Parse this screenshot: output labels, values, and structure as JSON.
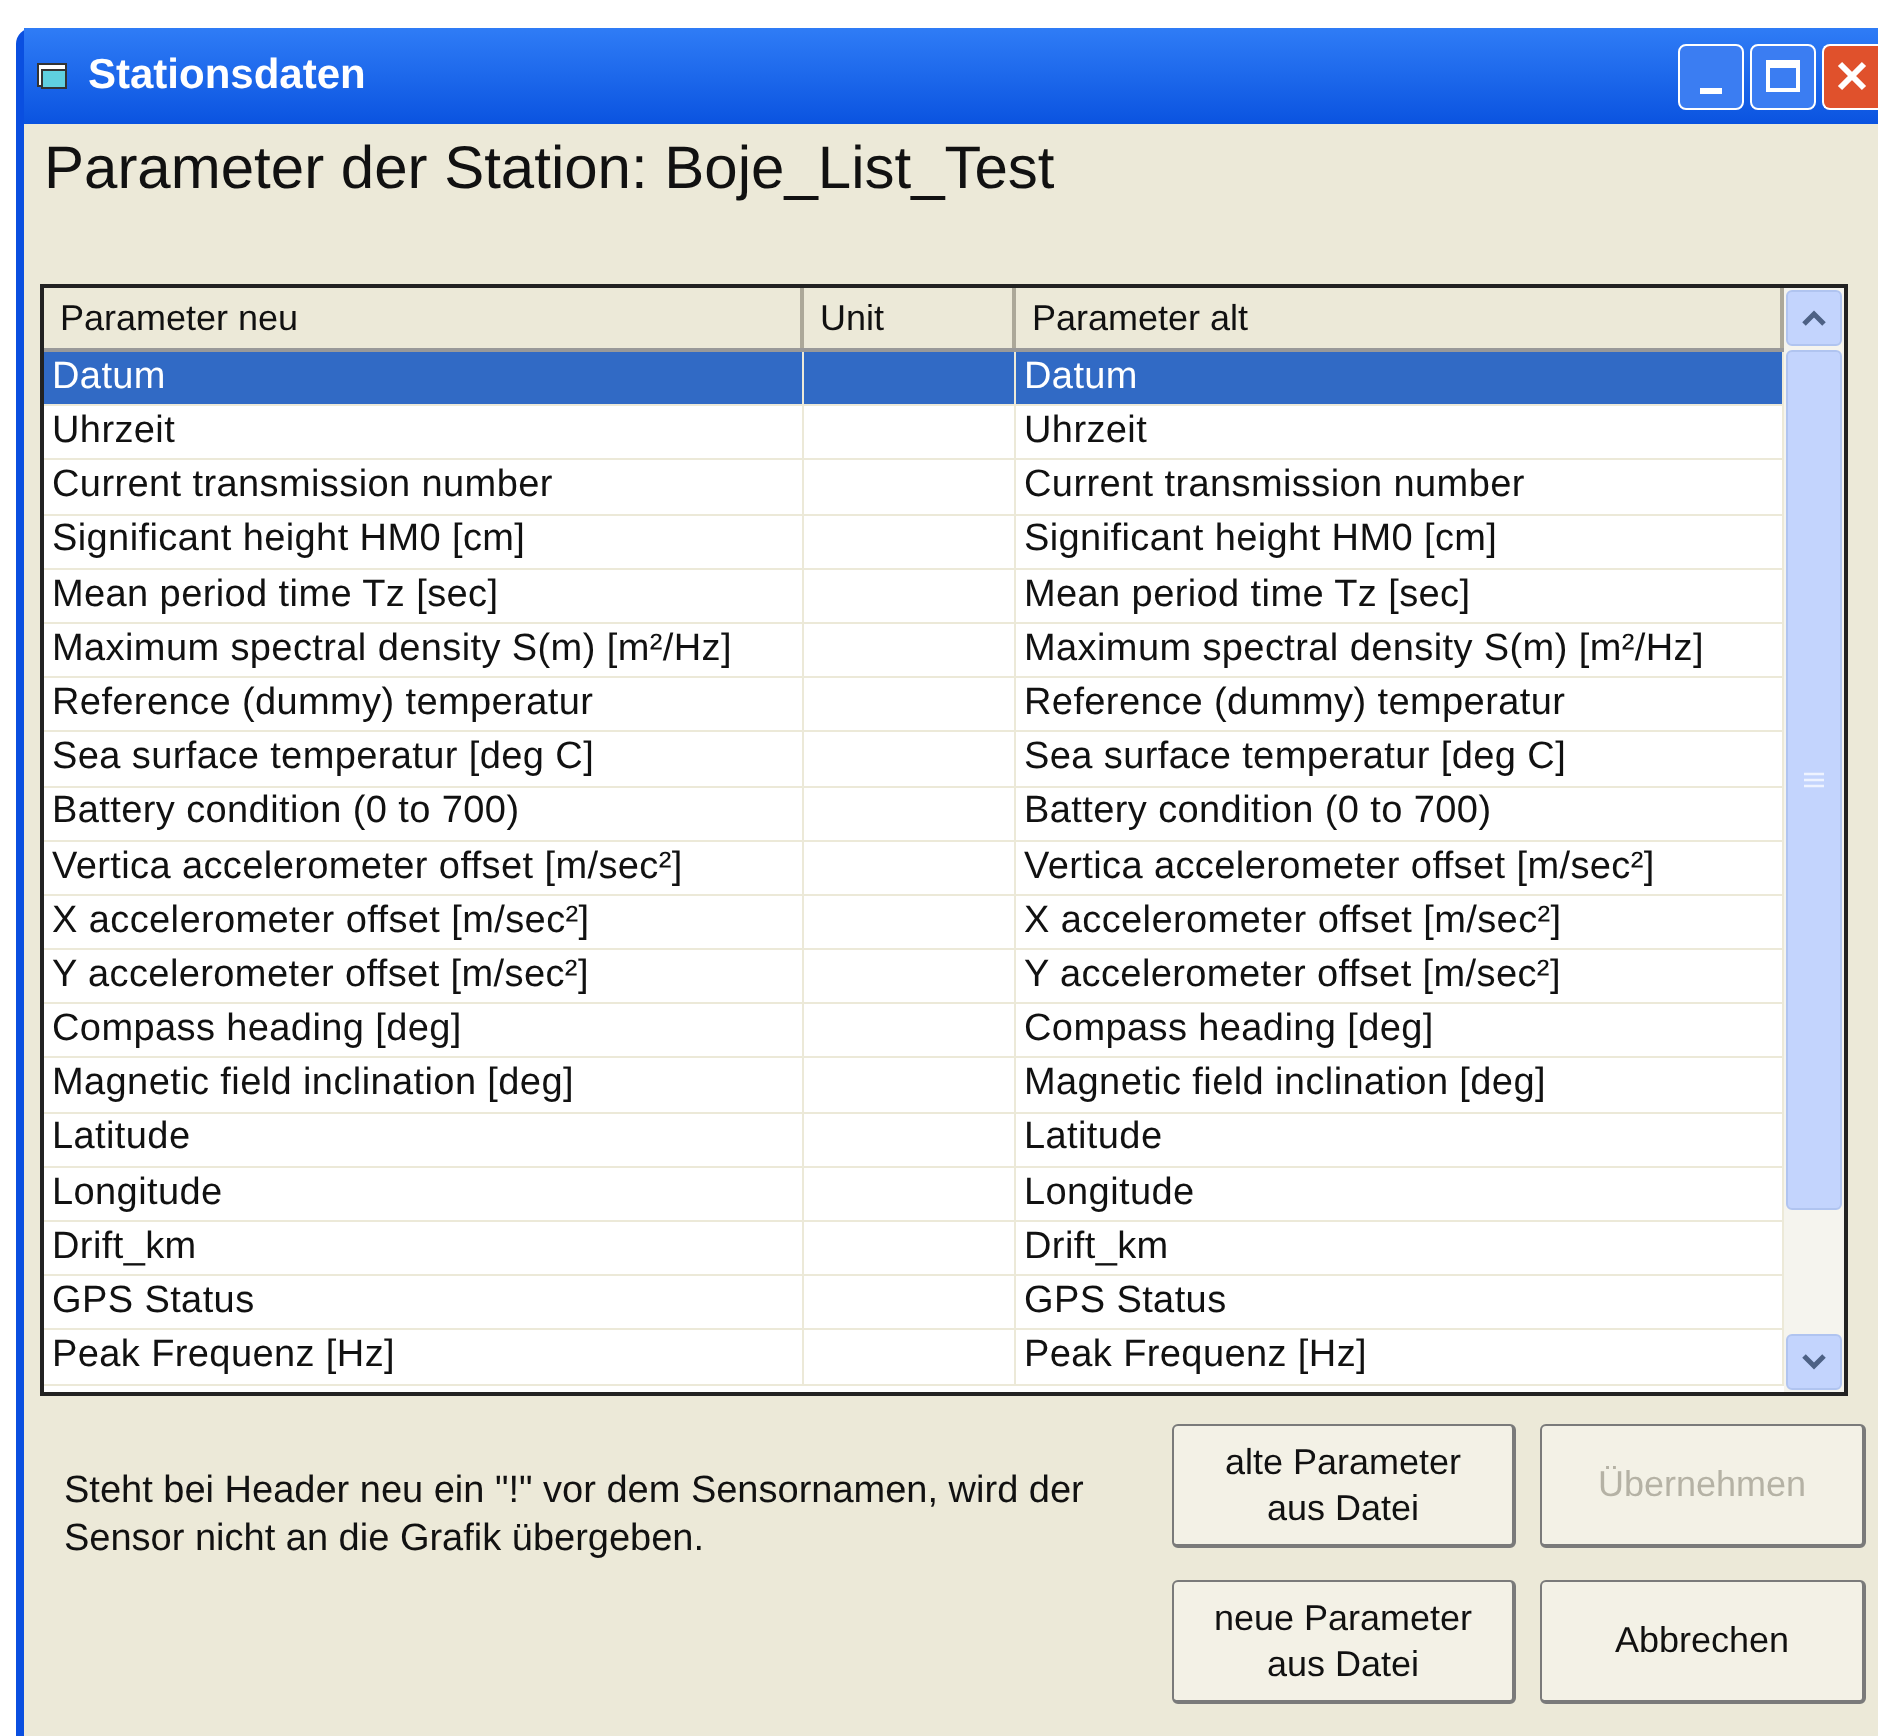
{
  "window": {
    "title": "Stationsdaten"
  },
  "heading": "Parameter der Station: Boje_List_Test",
  "table": {
    "columns": [
      "Parameter neu",
      "Unit",
      "Parameter alt"
    ],
    "rows": [
      {
        "cells": [
          "Datum",
          "",
          "Datum"
        ],
        "selected": true
      },
      {
        "cells": [
          "Uhrzeit",
          "",
          "Uhrzeit"
        ],
        "selected": false
      },
      {
        "cells": [
          "Current transmission number",
          "",
          "Current transmission number"
        ],
        "selected": false
      },
      {
        "cells": [
          "Significant height HM0 [cm]",
          "",
          "Significant height HM0 [cm]"
        ],
        "selected": false
      },
      {
        "cells": [
          "Mean period time Tz [sec]",
          "",
          "Mean period time Tz [sec]"
        ],
        "selected": false
      },
      {
        "cells": [
          "Maximum spectral density S(m) [m²/Hz]",
          "",
          "Maximum spectral density S(m) [m²/Hz]"
        ],
        "selected": false
      },
      {
        "cells": [
          "Reference (dummy) temperatur",
          "",
          "Reference (dummy) temperatur"
        ],
        "selected": false
      },
      {
        "cells": [
          "Sea surface temperatur [deg C]",
          "",
          "Sea surface temperatur [deg C]"
        ],
        "selected": false
      },
      {
        "cells": [
          "Battery condition (0 to 700)",
          "",
          "Battery condition (0 to 700)"
        ],
        "selected": false
      },
      {
        "cells": [
          "Vertica accelerometer offset [m/sec²]",
          "",
          "Vertica accelerometer offset [m/sec²]"
        ],
        "selected": false
      },
      {
        "cells": [
          "X accelerometer offset [m/sec²]",
          "",
          "X accelerometer offset [m/sec²]"
        ],
        "selected": false
      },
      {
        "cells": [
          "Y accelerometer offset [m/sec²]",
          "",
          "Y accelerometer offset [m/sec²]"
        ],
        "selected": false
      },
      {
        "cells": [
          "Compass heading [deg]",
          "",
          "Compass heading [deg]"
        ],
        "selected": false
      },
      {
        "cells": [
          "Magnetic field inclination [deg]",
          "",
          "Magnetic field inclination [deg]"
        ],
        "selected": false
      },
      {
        "cells": [
          "Latitude",
          "",
          "Latitude"
        ],
        "selected": false
      },
      {
        "cells": [
          "Longitude",
          "",
          "Longitude"
        ],
        "selected": false
      },
      {
        "cells": [
          "Drift_km",
          "",
          "Drift_km"
        ],
        "selected": false
      },
      {
        "cells": [
          "GPS Status",
          "",
          "GPS Status"
        ],
        "selected": false
      },
      {
        "cells": [
          "Peak Frequenz [Hz]",
          "",
          "Peak Frequenz [Hz]"
        ],
        "selected": false
      }
    ]
  },
  "note": "Steht bei Header neu ein \"!\" vor dem Sensornamen, wird der Sensor nicht an die Grafik übergeben.",
  "buttons": [
    {
      "label": "alte Parameter aus Datei",
      "disabled": false
    },
    {
      "label": "Übernehmen",
      "disabled": true
    },
    {
      "label": "neue Parameter aus Datei",
      "disabled": false
    },
    {
      "label": "Abbrechen",
      "disabled": false
    }
  ]
}
